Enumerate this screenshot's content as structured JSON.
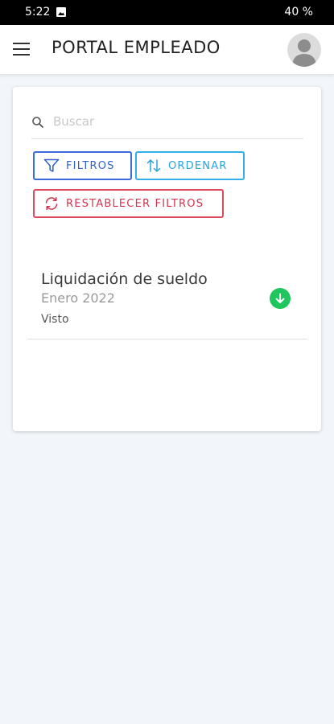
{
  "status_bar": {
    "time": "5:22",
    "battery": "40 %"
  },
  "app_bar": {
    "title": "PORTAL EMPLEADO"
  },
  "search": {
    "placeholder": "Buscar",
    "value": ""
  },
  "buttons": {
    "filters": "FILTROS",
    "sort": "ORDENAR",
    "reset": "RESTABLECER FILTROS"
  },
  "documents": [
    {
      "title": "Liquidación de sueldo",
      "period": "Enero 2022",
      "status": "Visto"
    }
  ],
  "colors": {
    "filters": "#3b6bd6",
    "sort": "#33aee6",
    "reset": "#dc4a60",
    "download": "#1fc65c"
  }
}
